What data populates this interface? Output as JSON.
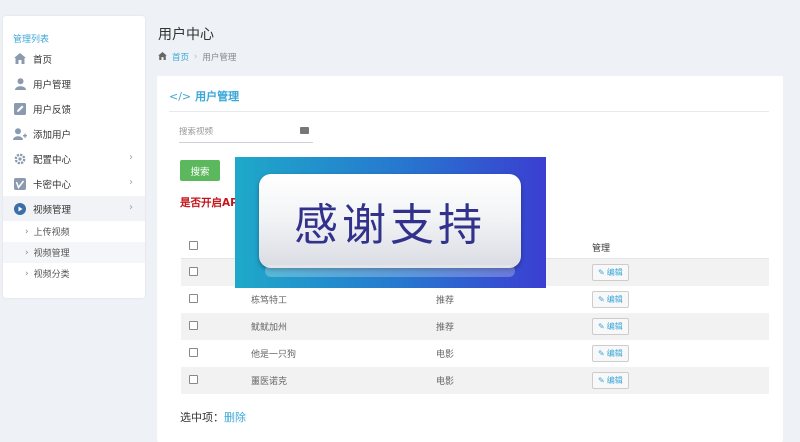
{
  "sidebar": {
    "title": "管理列表",
    "items": [
      {
        "label": "首页",
        "icon": "home-icon",
        "arrow": false
      },
      {
        "label": "用户管理",
        "icon": "user-icon",
        "arrow": false
      },
      {
        "label": "用户反馈",
        "icon": "edit-icon",
        "arrow": false
      },
      {
        "label": "添加用户",
        "icon": "add-user-icon",
        "arrow": false
      },
      {
        "label": "配置中心",
        "icon": "gear-icon",
        "arrow": true
      },
      {
        "label": "卡密中心",
        "icon": "vimeo-icon",
        "arrow": true
      },
      {
        "label": "视频管理",
        "icon": "play-icon",
        "arrow": true
      }
    ],
    "submenu": [
      {
        "label": "上传视频"
      },
      {
        "label": "视频管理"
      },
      {
        "label": "视频分类"
      }
    ]
  },
  "header": {
    "title": "用户中心",
    "breadcrumb": {
      "home": "首页",
      "current": "用户管理"
    }
  },
  "panel": {
    "title": "用户管理",
    "search_placeholder": "搜索视频",
    "search_button": "搜索",
    "api_label": "是否开启AP",
    "table": {
      "op_header": "管理",
      "rows": [
        {
          "name": "",
          "type": "",
          "edit": "编辑"
        },
        {
          "name": "栋笃特工",
          "type": "推荐",
          "edit": "编辑"
        },
        {
          "name": "鱿鱿加州",
          "type": "推荐",
          "edit": "编辑"
        },
        {
          "name": "他是一只狗",
          "type": "电影",
          "edit": "编辑"
        },
        {
          "name": "噩医诺克",
          "type": "电影",
          "edit": "编辑"
        }
      ]
    },
    "footer": {
      "label": "选中项：",
      "delete": "删除"
    }
  },
  "banner": {
    "text": "感谢支持"
  },
  "colors": {
    "accent": "#3aa7d8",
    "green": "#5cb85c",
    "red": "#c3151b"
  }
}
